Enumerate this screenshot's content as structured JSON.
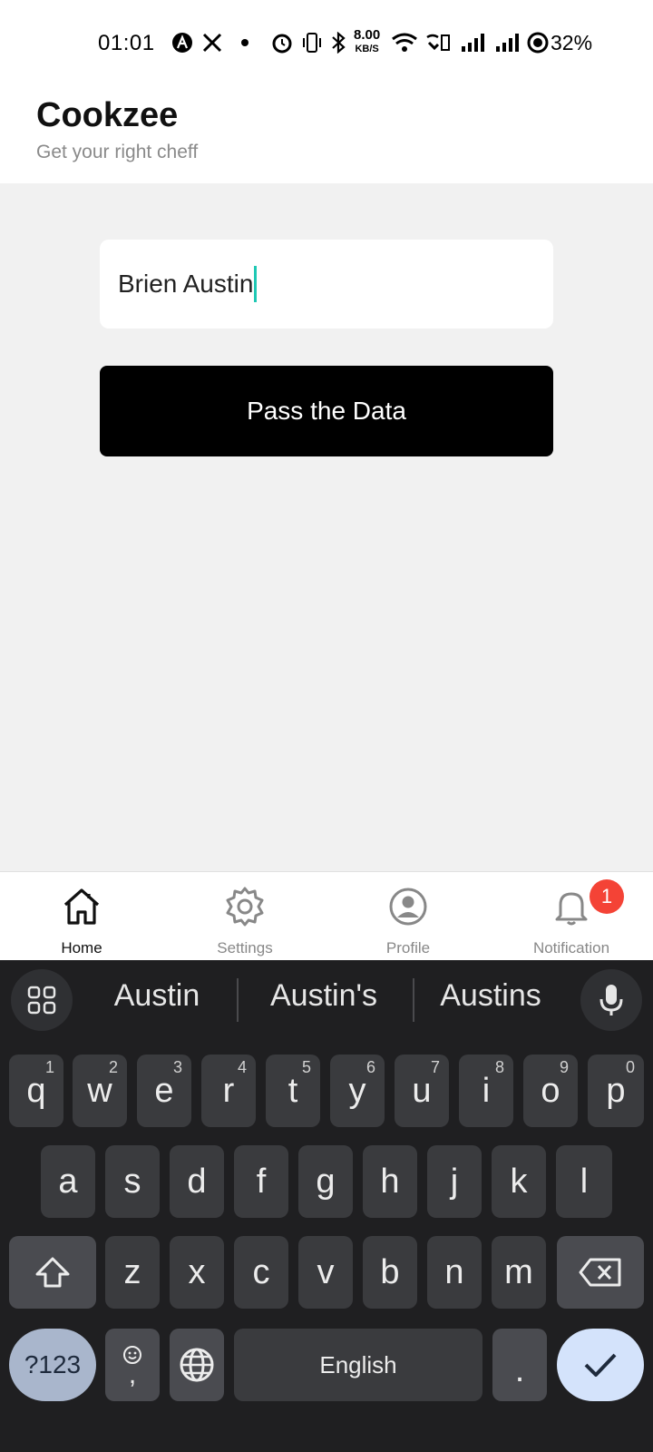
{
  "status_bar": {
    "time": "01:01",
    "network_speed_value": "8.00",
    "network_speed_unit": "KB/S",
    "battery": "32%"
  },
  "app": {
    "title": "Cookzee",
    "subtitle": "Get your right cheff"
  },
  "form": {
    "name_value": "Brien Austin",
    "submit_label": "Pass the Data"
  },
  "bottom_nav": {
    "items": [
      {
        "label": "Home",
        "icon": "home-icon",
        "active": true
      },
      {
        "label": "Settings",
        "icon": "gear-icon",
        "active": false
      },
      {
        "label": "Profile",
        "icon": "user-icon",
        "active": false
      },
      {
        "label": "Notification",
        "icon": "bell-icon",
        "active": false,
        "badge": "1"
      }
    ]
  },
  "keyboard": {
    "suggestions": [
      "Austin",
      "Austin's",
      "Austins"
    ],
    "row1": [
      "q",
      "w",
      "e",
      "r",
      "t",
      "y",
      "u",
      "i",
      "o",
      "p"
    ],
    "row1_hints": [
      "1",
      "2",
      "3",
      "4",
      "5",
      "6",
      "7",
      "8",
      "9",
      "0"
    ],
    "row2": [
      "a",
      "s",
      "d",
      "f",
      "g",
      "h",
      "j",
      "k",
      "l"
    ],
    "row3": [
      "z",
      "x",
      "c",
      "v",
      "b",
      "n",
      "m"
    ],
    "symbols_label": "?123",
    "comma_label": ",",
    "space_label": "English",
    "period_label": "."
  },
  "colors": {
    "accent_caret": "#1fc8b4",
    "badge": "#f44336",
    "button_bg": "#000000"
  }
}
